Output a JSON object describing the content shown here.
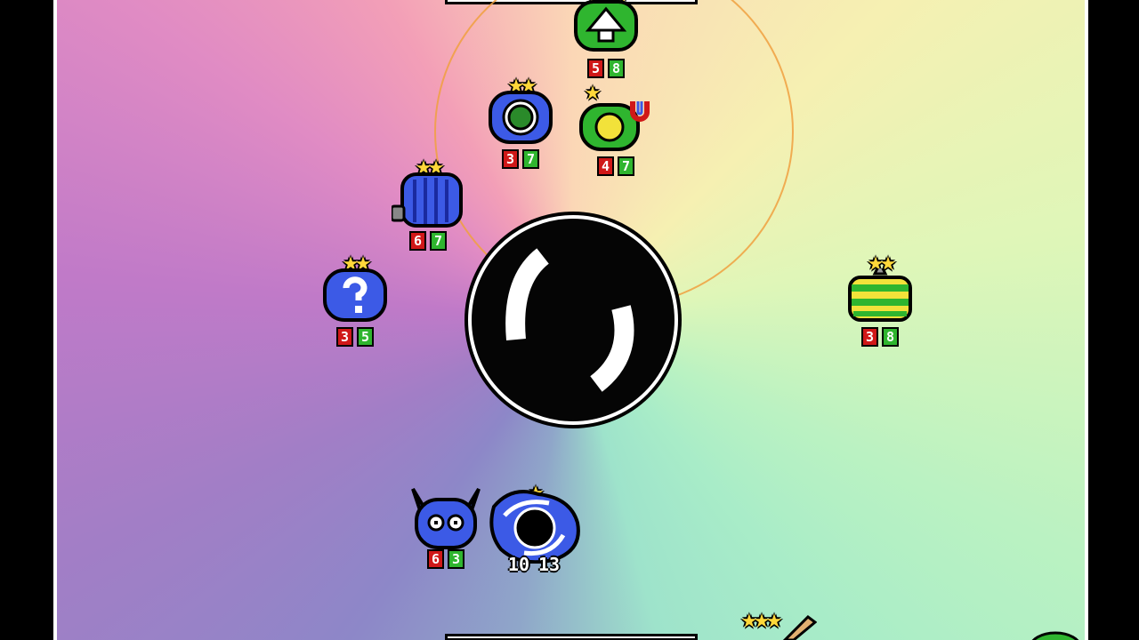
{
  "board": {
    "units": [
      {
        "id": "top-green-arrow",
        "stars": "★★★",
        "atk": "5",
        "hp": "8",
        "color": "#2fb52f",
        "icon": "arrow-up-icon"
      },
      {
        "id": "blue-clover",
        "stars": "★★",
        "atk": "3",
        "hp": "7",
        "color": "#3c5ae6",
        "icon": "clover-icon"
      },
      {
        "id": "green-magnet",
        "stars": "★",
        "atk": "4",
        "hp": "7",
        "color": "#2fb52f",
        "icon": "magnet-icon"
      },
      {
        "id": "blue-striped",
        "stars": "★★",
        "atk": "6",
        "hp": "7",
        "color": "#3c5ae6",
        "icon": "striped-blob-icon"
      },
      {
        "id": "blue-question",
        "stars": "★★",
        "atk": "3",
        "hp": "5",
        "color": "#3c5ae6",
        "icon": "question-mark-icon"
      },
      {
        "id": "green-yellow-striped",
        "stars": "★★",
        "atk": "3",
        "hp": "8",
        "color": "#7ccf2a",
        "icon": "striped-blob-icon"
      },
      {
        "id": "blue-horned",
        "stars": "",
        "atk": "6",
        "hp": "3",
        "color": "#3c5ae6",
        "icon": "horned-face-icon"
      },
      {
        "id": "black-hole",
        "stars": "★",
        "atk": "10",
        "hp": "13",
        "color": "#3c5ae6",
        "icon": "vortex-icon"
      },
      {
        "id": "bottom-partial",
        "stars": "★★★",
        "atk": "",
        "hp": "",
        "color": "#e0b070",
        "icon": "partial-unit-icon"
      }
    ]
  }
}
